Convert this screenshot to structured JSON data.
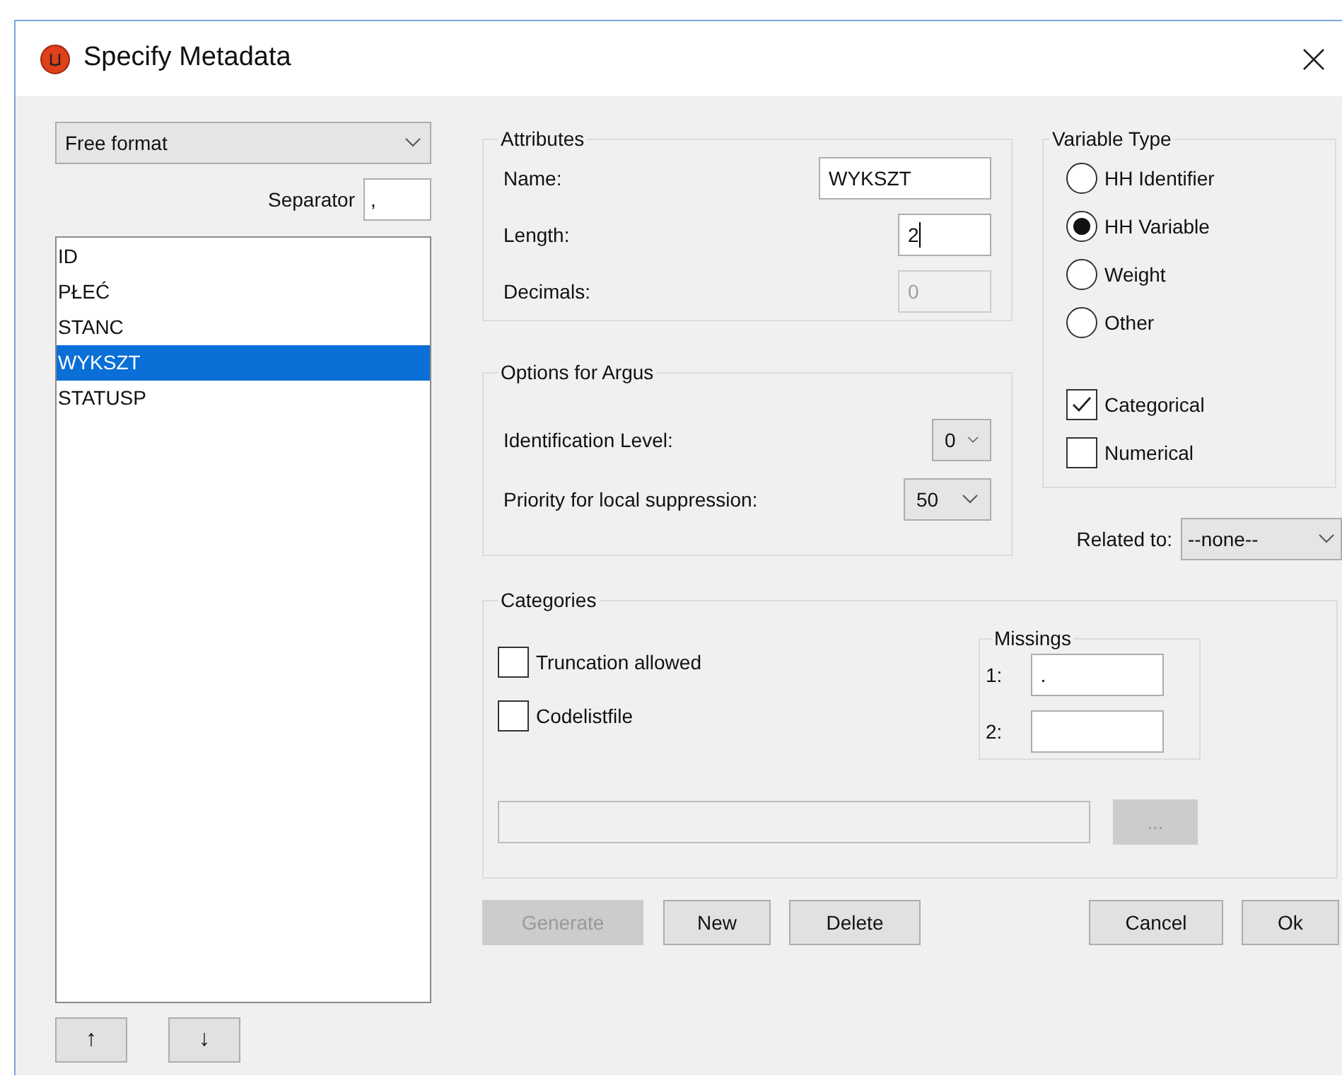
{
  "window": {
    "title": "Specify Metadata"
  },
  "format_select": {
    "value": "Free format"
  },
  "separator": {
    "label": "Separator",
    "value": ","
  },
  "variables": [
    {
      "name": "ID",
      "selected": false
    },
    {
      "name": "PŁEĆ",
      "selected": false
    },
    {
      "name": "STANC",
      "selected": false
    },
    {
      "name": "WYKSZT",
      "selected": true
    },
    {
      "name": "STATUSP",
      "selected": false
    }
  ],
  "move_buttons": [
    {
      "label": "↑"
    },
    {
      "label": "↓"
    }
  ],
  "attributes": {
    "title": "Attributes",
    "fields": [
      {
        "label": "Name:",
        "value": "WYKSZT",
        "disabled": false,
        "focused": false
      },
      {
        "label": "Length:",
        "value": "2",
        "disabled": false,
        "focused": true
      },
      {
        "label": "Decimals:",
        "value": "0",
        "disabled": true,
        "focused": false
      }
    ]
  },
  "options": {
    "title": "Options for Argus",
    "fields": [
      {
        "label": "Identification Level:",
        "value": "0"
      },
      {
        "label": "Priority for local suppression:",
        "value": "50"
      }
    ]
  },
  "variable_type": {
    "title": "Variable Type",
    "radios": [
      {
        "label": "HH Identifier",
        "selected": false
      },
      {
        "label": "HH Variable",
        "selected": true
      },
      {
        "label": "Weight",
        "selected": false
      },
      {
        "label": "Other",
        "selected": false
      }
    ],
    "checkboxes": [
      {
        "label": "Categorical",
        "checked": true
      },
      {
        "label": "Numerical",
        "checked": false
      }
    ]
  },
  "related_to": {
    "label": "Related to:",
    "value": "--none--"
  },
  "categories": {
    "title": "Categories",
    "checkboxes": [
      {
        "label": "Truncation allowed",
        "checked": false
      },
      {
        "label": "Codelistfile",
        "checked": false
      }
    ],
    "missings": {
      "title": "Missings",
      "fields": [
        {
          "label": "1:",
          "value": "."
        },
        {
          "label": "2:"
        }
      ]
    },
    "browse_button": {
      "label": "...",
      "disabled": true
    }
  },
  "buttons": [
    {
      "label": "Generate",
      "disabled": true
    },
    {
      "label": "New",
      "disabled": false
    },
    {
      "label": "Delete",
      "disabled": false
    },
    {
      "label": "Cancel",
      "disabled": false
    },
    {
      "label": "Ok",
      "disabled": false
    }
  ]
}
